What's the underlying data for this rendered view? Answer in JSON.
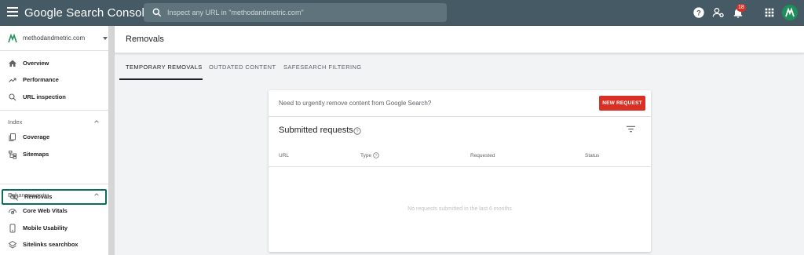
{
  "app": {
    "title": "Google Search Console"
  },
  "search": {
    "placeholder": "Inspect any URL in \"methodandmetric.com\""
  },
  "topbar": {
    "notification_count": "18"
  },
  "property": {
    "name": "methodandmetric.com"
  },
  "sidebar": {
    "items": [
      {
        "label": "Overview"
      },
      {
        "label": "Performance"
      },
      {
        "label": "URL inspection"
      }
    ],
    "index_label": "Index",
    "index_items": [
      {
        "label": "Coverage"
      },
      {
        "label": "Sitemaps"
      },
      {
        "label": "Removals"
      }
    ],
    "enhancements_label": "Enhancements",
    "enhancement_items": [
      {
        "label": "Core Web Vitals"
      },
      {
        "label": "Mobile Usability"
      },
      {
        "label": "Sitelinks searchbox"
      }
    ]
  },
  "page": {
    "title": "Removals"
  },
  "tabs": [
    {
      "label": "TEMPORARY REMOVALS"
    },
    {
      "label": "OUTDATED CONTENT"
    },
    {
      "label": "SAFESEARCH FILTERING"
    }
  ],
  "card": {
    "prompt": "Need to urgently remove content from Google Search?",
    "new_request_label": "NEW REQUEST",
    "heading": "Submitted requests",
    "columns": [
      "URL",
      "Type",
      "Requested",
      "Status"
    ],
    "empty_message": "No requests submitted in the last 6 months"
  },
  "colors": {
    "topbar": "#455a64",
    "accent": "#d93025",
    "active_border": "#0d6e5f",
    "avatar": "#1e8e5a"
  }
}
